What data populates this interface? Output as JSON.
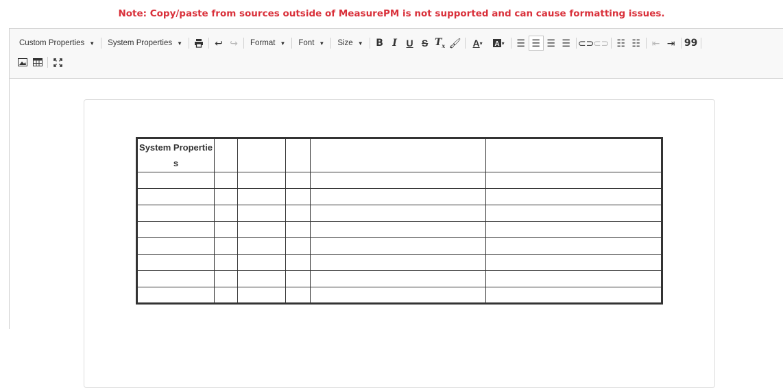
{
  "notice": "Note: Copy/paste from sources outside of MeasurePM is not supported and can cause formatting issues.",
  "toolbar": {
    "custom_properties": "Custom Properties",
    "system_properties": "System Properties",
    "format": "Format",
    "font": "Font",
    "size": "Size",
    "bold": "B",
    "italic": "I",
    "underline": "U",
    "strike": "S",
    "clear_format": "Tx",
    "quote": "99"
  },
  "table": {
    "header_cell": "System Properties",
    "rows": 9,
    "cols": 6
  }
}
